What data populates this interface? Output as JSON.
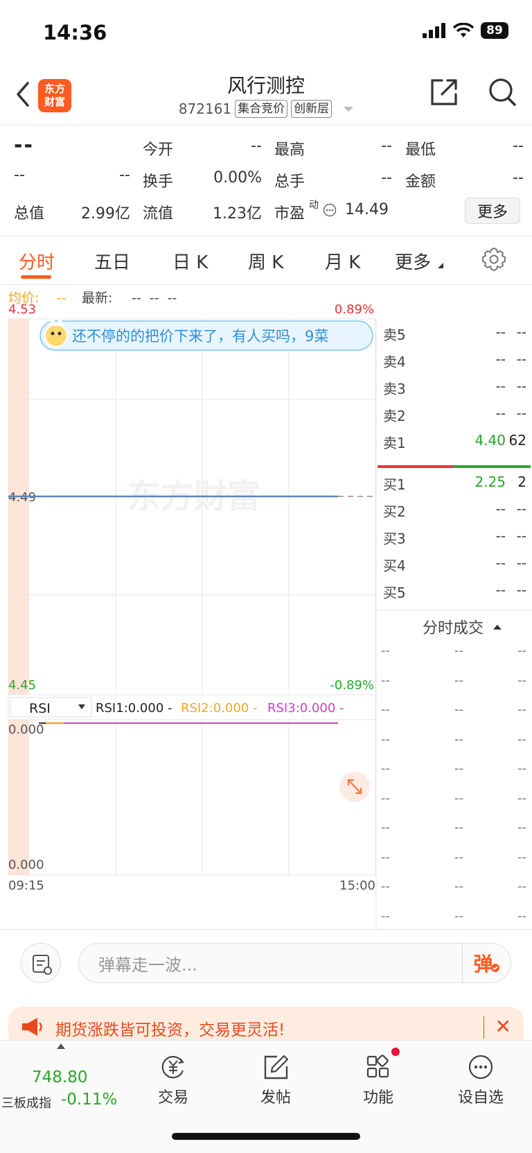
{
  "status": {
    "time": "14:36",
    "battery": "89"
  },
  "header": {
    "logo_line1": "东方",
    "logo_line2": "财富",
    "stock_name": "风行测控",
    "stock_code": "872161",
    "tag1": "集合竞价",
    "tag2": "创新层"
  },
  "quote": {
    "price": "--",
    "change": "--",
    "change_pct": "--",
    "open_label": "今开",
    "open": "--",
    "high_label": "最高",
    "high": "--",
    "low_label": "最低",
    "low": "--",
    "turnover_label": "换手",
    "turnover": "0.00%",
    "volume_label": "总手",
    "volume": "--",
    "amount_label": "金额",
    "amount": "--",
    "mktcap_label": "总值",
    "mktcap": "2.99亿",
    "float_label": "流值",
    "float": "1.23亿",
    "pe_label": "市盈",
    "pe_sup": "动",
    "pe": "14.49",
    "more_label": "更多"
  },
  "tabs": [
    {
      "label": "分时"
    },
    {
      "label": "五日"
    },
    {
      "label": "日 K"
    },
    {
      "label": "周 K"
    },
    {
      "label": "月 K"
    },
    {
      "label": "更多"
    }
  ],
  "chart": {
    "avg_label": "均价:",
    "avg_value": "--",
    "latest_label": "最新:",
    "latest_value": "--  --  --",
    "y_top": "4.53",
    "y_mid": "4.49",
    "y_bottom": "4.45",
    "pct_top": "0.89%",
    "pct_bottom": "-0.89%",
    "watermark": "东方财富",
    "danmu_text": "还不停的的把价下来了，有人买吗，9菜",
    "indicator_select": "RSI",
    "rsi1": "RSI1:0.000 -",
    "rsi2": "RSI2:0.000 -",
    "rsi3": "RSI3:0.000 -",
    "rsi_top": "0.000",
    "rsi_bottom": "0.000",
    "time_start": "09:15",
    "time_end": "15:00",
    "colors": {
      "price_line": "#5b86b5",
      "up": "#e8333a",
      "down": "#2aa52a",
      "avg": "#f5a623",
      "rsi3": "#d63ad6"
    }
  },
  "order_book": {
    "asks": [
      {
        "label": "卖5",
        "price": "--",
        "vol": "--"
      },
      {
        "label": "卖4",
        "price": "--",
        "vol": "--"
      },
      {
        "label": "卖3",
        "price": "--",
        "vol": "--"
      },
      {
        "label": "卖2",
        "price": "--",
        "vol": "--"
      },
      {
        "label": "卖1",
        "price": "4.40",
        "vol": "62"
      }
    ],
    "bids": [
      {
        "label": "买1",
        "price": "2.25",
        "vol": "2"
      },
      {
        "label": "买2",
        "price": "--",
        "vol": "--"
      },
      {
        "label": "买3",
        "price": "--",
        "vol": "--"
      },
      {
        "label": "买4",
        "price": "--",
        "vol": "--"
      },
      {
        "label": "买5",
        "price": "--",
        "vol": "--"
      }
    ]
  },
  "trades": {
    "title": "分时成交",
    "rows": [
      [
        "--",
        "--",
        "--"
      ],
      [
        "--",
        "--",
        "--"
      ],
      [
        "--",
        "--",
        "--"
      ],
      [
        "--",
        "--",
        "--"
      ],
      [
        "--",
        "--",
        "--"
      ],
      [
        "--",
        "--",
        "--"
      ],
      [
        "--",
        "--",
        "--"
      ],
      [
        "--",
        "--",
        "--"
      ],
      [
        "--",
        "--",
        "--"
      ],
      [
        "--",
        "--",
        "--"
      ]
    ]
  },
  "comment": {
    "placeholder": "弹幕走一波...",
    "send": "弹"
  },
  "promo": {
    "text": "期货涨跌皆可投资，交易更灵活!"
  },
  "bottom_nav": {
    "index_value": "748.80",
    "index_name": "三板成指",
    "index_change": "-0.11%",
    "items": [
      {
        "label": "交易"
      },
      {
        "label": "发帖"
      },
      {
        "label": "功能"
      },
      {
        "label": "设自选"
      }
    ]
  }
}
